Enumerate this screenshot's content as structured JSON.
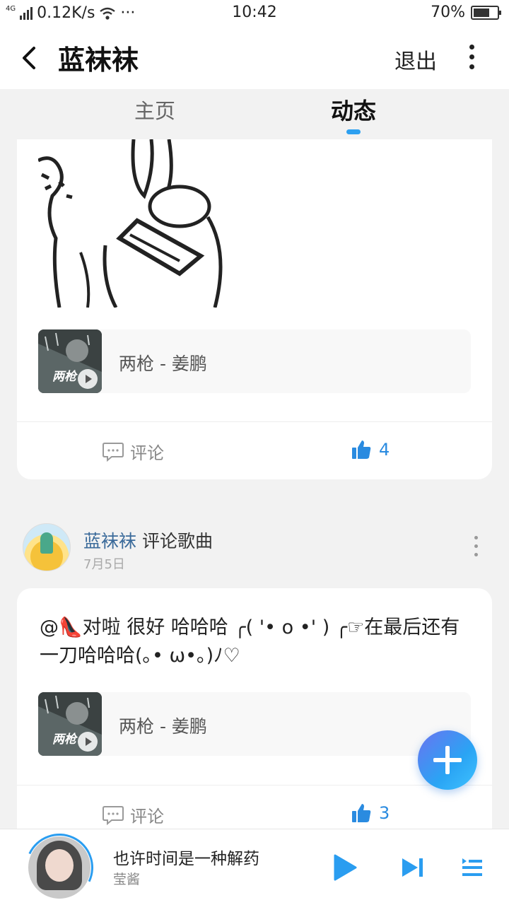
{
  "status_bar": {
    "network": "4G",
    "speed": "0.12K/s",
    "more": "···",
    "time": "10:42",
    "battery": "70%",
    "battery_level": 0.7
  },
  "header": {
    "back_icon": "chevron-left-icon",
    "title": "蓝袜袜",
    "logout_label": "退出",
    "more_icon": "vertical-dots-icon"
  },
  "tabs": [
    {
      "label": "主页",
      "active": false
    },
    {
      "label": "动态",
      "active": true
    }
  ],
  "accent_color": "#2da0f0",
  "feed": [
    {
      "song": {
        "title": "两枪 - 姜鹏",
        "cover_text": "两枪"
      },
      "comment_label": "评论",
      "like_count": "4"
    },
    {
      "user_name": "蓝袜袜",
      "action": "评论歌曲",
      "date": "7月5日",
      "text": "@👠对啦 很好 哈哈哈 ╭( '• o •' ) ╭☞在最后还有一刀哈哈哈(｡• ω•｡)ﾉ♡",
      "song": {
        "title": "两枪 - 姜鹏",
        "cover_text": "两枪"
      },
      "comment_label": "评论",
      "like_count": "3"
    }
  ],
  "player": {
    "title": "也许时间是一种解药",
    "artist": "莹酱",
    "play_icon": "play-icon",
    "next_icon": "skip-next-icon",
    "playlist_icon": "playlist-icon"
  }
}
